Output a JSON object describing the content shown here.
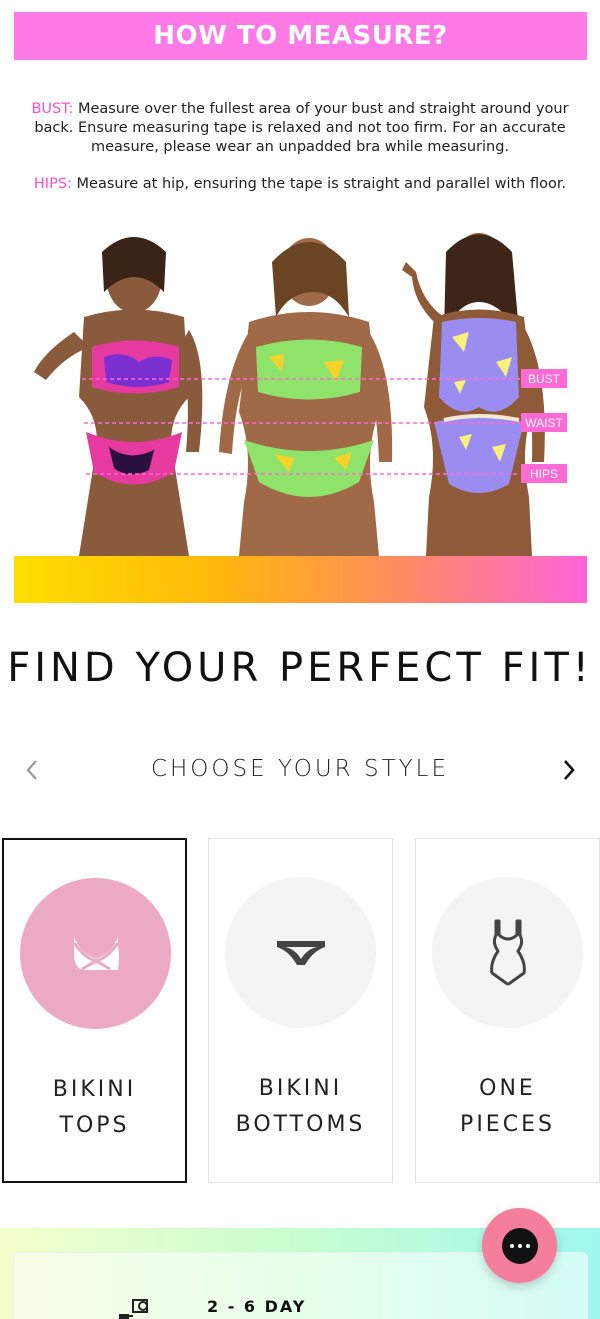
{
  "measure": {
    "title": "HOW TO MEASURE?",
    "bust_label": "BUST:",
    "bust_text": " Measure over the fullest area of your bust and straight around your back. Ensure measuring tape is relaxed and not too firm. For an accurate measure, please wear an unpadded bra while measuring.",
    "hips_label": "HIPS:",
    "hips_text": " Measure at hip, ensuring the tape is straight and parallel with floor."
  },
  "figure": {
    "tags": [
      "BUST",
      "WAIST",
      "HIPS"
    ]
  },
  "fit": {
    "heading": "FIND YOUR PERFECT FIT!"
  },
  "style_nav": {
    "title": "CHOOSE YOUR STYLE",
    "prev_icon": "chevron-left-icon",
    "next_icon": "chevron-right-icon"
  },
  "styles": [
    {
      "line1": "BIKINI",
      "line2": "TOPS",
      "icon": "bra-icon",
      "selected": true
    },
    {
      "line1": "BIKINI",
      "line2": "BOTTOMS",
      "icon": "bikini-bottom-icon",
      "selected": false
    },
    {
      "line1": "ONE",
      "line2": "PIECES",
      "icon": "one-piece-icon",
      "selected": false
    }
  ],
  "delivery": {
    "text": "2 - 6 DAY",
    "icon": "delivery-icon"
  },
  "chat": {
    "icon": "chat-icon"
  },
  "colors": {
    "banner_pink": "#ff7ae6",
    "label_pink": "#ff4fd0",
    "tag_pink": "#ff6ad5",
    "active_circle": "#eba9c3",
    "chat_button": "#f57e9c"
  }
}
